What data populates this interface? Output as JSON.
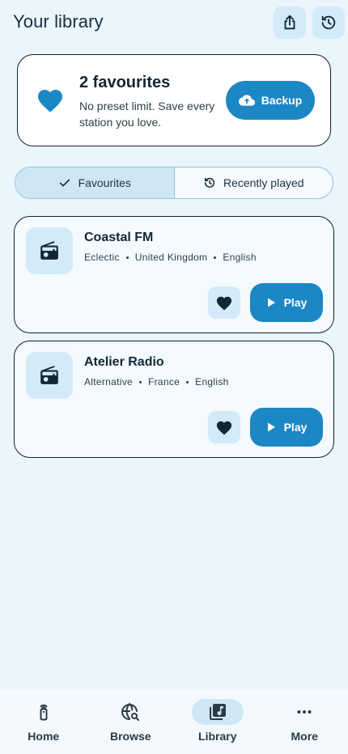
{
  "header": {
    "title": "Your library",
    "share_icon": "share-icon",
    "restore_icon": "restore-history-icon"
  },
  "summary": {
    "icon": "heart-icon",
    "title": "2 favourites",
    "description": "No preset limit. Save every station you love.",
    "backup_label": "Backup",
    "backup_icon": "cloud-upload-icon"
  },
  "tabs": [
    {
      "label": "Favourites",
      "icon": "check-icon",
      "active": true
    },
    {
      "label": "Recently played",
      "icon": "history-icon",
      "active": false
    }
  ],
  "stations": [
    {
      "name": "Coastal FM",
      "genre": "Eclectic",
      "country": "United Kingdom",
      "language": "English",
      "play_label": "Play",
      "favourite": true
    },
    {
      "name": "Atelier Radio",
      "genre": "Alternative",
      "country": "France",
      "language": "English",
      "play_label": "Play",
      "favourite": true
    }
  ],
  "nav": [
    {
      "label": "Home",
      "icon": "remote-icon",
      "active": false
    },
    {
      "label": "Browse",
      "icon": "browse-globe-icon",
      "active": false
    },
    {
      "label": "Library",
      "icon": "library-music-icon",
      "active": true
    },
    {
      "label": "More",
      "icon": "more-dots-icon",
      "active": false
    }
  ],
  "colors": {
    "background": "#eaf5fc",
    "accent": "#1b87c4",
    "tonal": "#d3ebf8",
    "text": "#142634"
  }
}
